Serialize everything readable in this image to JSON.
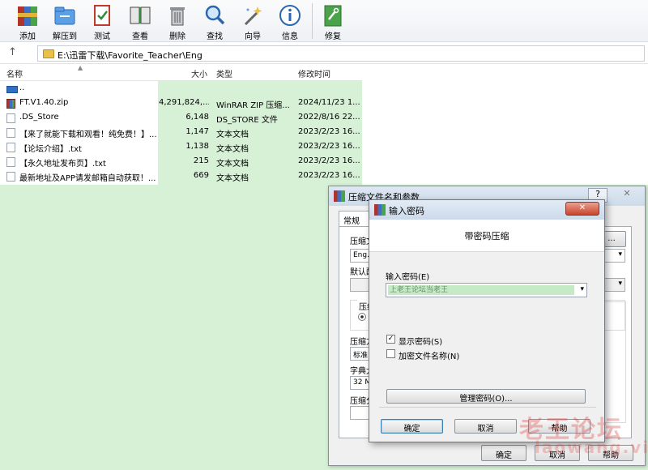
{
  "toolbar": {
    "items": [
      {
        "label": "添加",
        "icon": "add-archive-icon"
      },
      {
        "label": "解压到",
        "icon": "extract-to-icon"
      },
      {
        "label": "测试",
        "icon": "test-icon"
      },
      {
        "label": "查看",
        "icon": "view-icon"
      },
      {
        "label": "删除",
        "icon": "delete-icon"
      },
      {
        "label": "查找",
        "icon": "find-icon"
      },
      {
        "label": "向导",
        "icon": "wizard-icon"
      },
      {
        "label": "信息",
        "icon": "info-icon"
      },
      {
        "label": "修复",
        "icon": "repair-icon"
      }
    ]
  },
  "address": {
    "up_symbol": "↑",
    "path": "E:\\迅雷下载\\Favorite_Teacher\\Eng"
  },
  "list": {
    "columns": {
      "name": "名称",
      "size": "大小",
      "type": "类型",
      "modified": "修改时间"
    },
    "rows": [
      {
        "name": "..",
        "size": "",
        "type": "",
        "modified": "",
        "icon": "parent-folder-icon"
      },
      {
        "name": "FT.V1.40.zip",
        "size": "4,291,824,...",
        "type": "WinRAR ZIP 压缩...",
        "modified": "2024/11/23 1...",
        "icon": "winrar-zip-icon"
      },
      {
        "name": ".DS_Store",
        "size": "6,148",
        "type": "DS_STORE 文件",
        "modified": "2022/8/16 22...",
        "icon": "file-icon"
      },
      {
        "name": "【来了就能下载和观看！纯免费！】...",
        "size": "1,147",
        "type": "文本文档",
        "modified": "2023/2/23 16...",
        "icon": "text-file-icon"
      },
      {
        "name": "【论坛介绍】.txt",
        "size": "1,138",
        "type": "文本文档",
        "modified": "2023/2/23 16...",
        "icon": "text-file-icon"
      },
      {
        "name": "【永久地址发布页】.txt",
        "size": "215",
        "type": "文本文档",
        "modified": "2023/2/23 16...",
        "icon": "text-file-icon"
      },
      {
        "name": "最新地址及APP请发邮箱自动获取！...",
        "size": "669",
        "type": "文本文档",
        "modified": "2023/2/23 16...",
        "icon": "text-file-icon"
      }
    ]
  },
  "archive_dialog": {
    "title": "压缩文件名和参数",
    "help": "?",
    "close": "✕",
    "tab_general": "常规",
    "archive_name_label": "压缩文",
    "archive_name_value": "Eng.",
    "browse_button": "...",
    "default_profile_label": "默认配",
    "format_label": "压缩",
    "method_label": "压缩方",
    "method_value": "标准",
    "dict_label": "字典大",
    "dict_value": "32 M",
    "split_label": "压缩分",
    "ok_button": "确定",
    "cancel_button": "取消",
    "help_button": "帮助"
  },
  "password_dialog": {
    "title": "输入密码",
    "close": "✕",
    "heading": "带密码压缩",
    "enter_password_label": "输入密码(E)",
    "password_value": "上老王论坛当老王",
    "show_password_label": "显示密码(S)",
    "show_password_checked": true,
    "encrypt_names_label": "加密文件名称(N)",
    "encrypt_names_checked": false,
    "manage_button": "管理密码(O)...",
    "ok_button": "确定",
    "cancel_button": "取消",
    "help_button": "帮助"
  },
  "watermark": {
    "text": "老王论坛",
    "sub": "laowang.vip"
  }
}
